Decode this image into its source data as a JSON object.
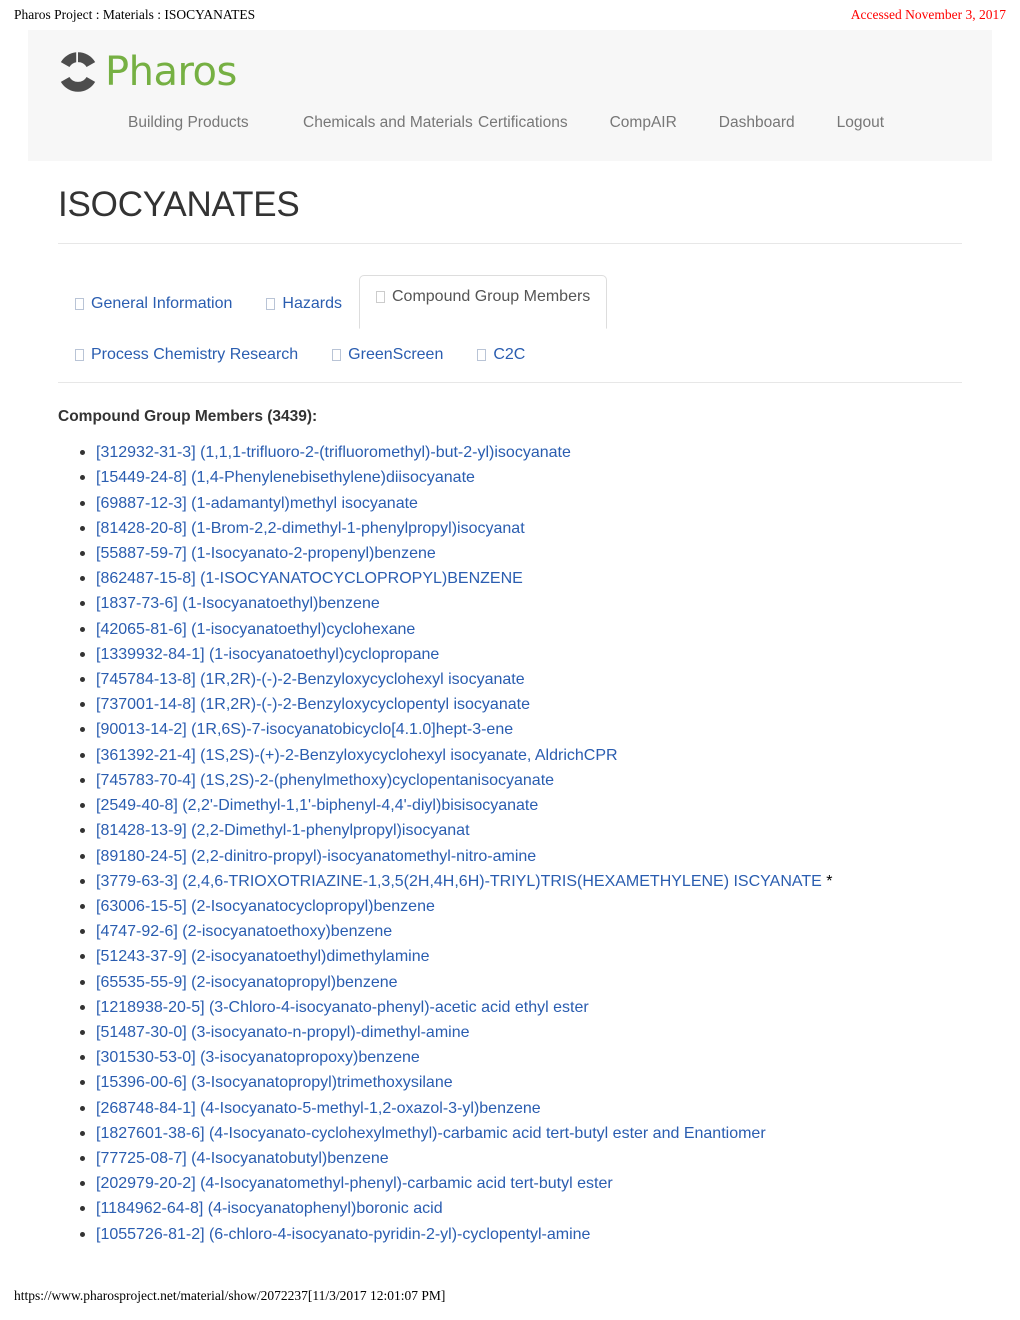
{
  "print_header": {
    "left": "Pharos Project : Materials : ISOCYANATES",
    "right": "Accessed November 3, 2017",
    "right_color": "#ff0000"
  },
  "print_footer": {
    "url_and_time": "https://www.pharosproject.net/material/show/2072237[11/3/2017 12:01:07 PM]"
  },
  "brand": {
    "logo_text": "Pharos",
    "logo_green": "#76b043",
    "logo_mark_color": "#4d4d4d"
  },
  "nav": {
    "items": [
      {
        "label": "Building Products"
      },
      {
        "label": "Chemicals and Materials"
      },
      {
        "label": "Certifications"
      },
      {
        "label": "CompAIR"
      },
      {
        "label": "Dashboard"
      },
      {
        "label": "Logout"
      }
    ]
  },
  "page": {
    "title": "ISOCYANATES"
  },
  "tabs": {
    "row1": [
      {
        "label": "General Information",
        "active": false
      },
      {
        "label": "Hazards",
        "active": false
      },
      {
        "label": "Compound Group Members",
        "active": true
      }
    ],
    "row2": [
      {
        "label": "Process Chemistry Research",
        "active": false
      },
      {
        "label": "GreenScreen",
        "active": false
      },
      {
        "label": "C2C",
        "active": false
      }
    ]
  },
  "members": {
    "heading": "Compound Group Members (3439):",
    "count": 3439,
    "link_color": "#2a5db0",
    "items": [
      {
        "text": "[312932-31-3] (1,1,1-trifluoro-2-(trifluoromethyl)-but-2-yl)isocyanate"
      },
      {
        "text": "[15449-24-8] (1,4-Phenylenebisethylene)diisocyanate"
      },
      {
        "text": "[69887-12-3] (1-adamantyl)methyl isocyanate"
      },
      {
        "text": "[81428-20-8] (1-Brom-2,2-dimethyl-1-phenylpropyl)isocyanat"
      },
      {
        "text": "[55887-59-7] (1-Isocyanato-2-propenyl)benzene"
      },
      {
        "text": "[862487-15-8] (1-ISOCYANATOCYCLOPROPYL)BENZENE"
      },
      {
        "text": "[1837-73-6] (1-Isocyanatoethyl)benzene"
      },
      {
        "text": "[42065-81-6] (1-isocyanatoethyl)cyclohexane"
      },
      {
        "text": "[1339932-84-1] (1-isocyanatoethyl)cyclopropane"
      },
      {
        "text": "[745784-13-8] (1R,2R)-(-)-2-Benzyloxycyclohexyl isocyanate"
      },
      {
        "text": "[737001-14-8] (1R,2R)-(-)-2-Benzyloxycyclopentyl isocyanate"
      },
      {
        "text": "[90013-14-2] (1R,6S)-7-isocyanatobicyclo[4.1.0]hept-3-ene"
      },
      {
        "text": "[361392-21-4] (1S,2S)-(+)-2-Benzyloxycyclohexyl isocyanate, AldrichCPR"
      },
      {
        "text": "[745783-70-4] (1S,2S)-2-(phenylmethoxy)cyclopentanisocyanate"
      },
      {
        "text": "[2549-40-8] (2,2'-Dimethyl-1,1'-biphenyl-4,4'-diyl)bisisocyanate"
      },
      {
        "text": "[81428-13-9] (2,2-Dimethyl-1-phenylpropyl)isocyanat"
      },
      {
        "text": "[89180-24-5] (2,2-dinitro-propyl)-isocyanatomethyl-nitro-amine"
      },
      {
        "text": "[3779-63-3] (2,4,6-TRIOXOTRIAZINE-1,3,5(2H,4H,6H)-TRIYL)TRIS(HEXAMETHYLENE) ISCYANATE",
        "star": "*"
      },
      {
        "text": "[63006-15-5] (2-Isocyanatocyclopropyl)benzene"
      },
      {
        "text": "[4747-92-6] (2-isocyanatoethoxy)benzene"
      },
      {
        "text": "[51243-37-9] (2-isocyanatoethyl)dimethylamine"
      },
      {
        "text": "[65535-55-9] (2-isocyanatopropyl)benzene"
      },
      {
        "text": "[1218938-20-5] (3-Chloro-4-isocyanato-phenyl)-acetic acid ethyl ester"
      },
      {
        "text": "[51487-30-0] (3-isocyanato-n-propyl)-dimethyl-amine"
      },
      {
        "text": "[301530-53-0] (3-isocyanatopropoxy)benzene"
      },
      {
        "text": "[15396-00-6] (3-Isocyanatopropyl)trimethoxysilane"
      },
      {
        "text": "[268748-84-1] (4-Isocyanato-5-methyl-1,2-oxazol-3-yl)benzene"
      },
      {
        "text": "[1827601-38-6] (4-Isocyanato-cyclohexylmethyl)-carbamic acid tert-butyl ester and Enantiomer"
      },
      {
        "text": "[77725-08-7] (4-Isocyanatobutyl)benzene"
      },
      {
        "text": "[202979-20-2] (4-Isocyanatomethyl-phenyl)-carbamic acid tert-butyl ester"
      },
      {
        "text": "[1184962-64-8] (4-isocyanatophenyl)boronic acid"
      },
      {
        "text": "[1055726-81-2] (6-chloro-4-isocyanato-pyridin-2-yl)-cyclopentyl-amine"
      }
    ]
  }
}
